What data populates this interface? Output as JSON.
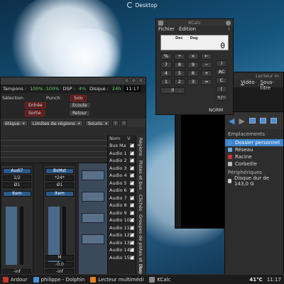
{
  "desktop": {
    "label": "Desktop"
  },
  "ardour": {
    "transport": {
      "tampons": "Tampons :",
      "tampons_val": "100% :100%",
      "dsp": "DSP :",
      "dsp_val": "4%",
      "disque": "Disque :",
      "disque_val": "24h",
      "time": "11:17"
    },
    "selection": "Sélection",
    "punch": "Punch",
    "entree": "Entrée",
    "sortie": "Sortie",
    "solo": "Solo",
    "ecoute": "Ecoute",
    "retour": "Retour",
    "row3": {
      "combo1": "étique",
      "combo2": "Limites de régions",
      "combo3": "Souris"
    },
    "list_headers": [
      "Nom",
      "V"
    ],
    "list_items": [
      "Bus Ma",
      "Audio 1",
      "Audio 2",
      "Audio 3",
      "Audio 4",
      "Audio 5",
      "Audio 6",
      "Audio 7",
      "Audio 8",
      "Audio 9",
      "Audio 10",
      "Audio 11",
      "Audio 12",
      "Audio 13",
      "Audio 14",
      "Audio 15"
    ],
    "vtabs": [
      "Régions",
      "Pistes et bus",
      "Clichés",
      "Groupes de pistes et bus",
      "Repè"
    ],
    "strip": {
      "name": "BsMst",
      "angle": "*24*",
      "in_label": "In",
      "out_label": "Ø1",
      "m": "M",
      "db": "-0.0",
      "inf": "-inf",
      "audi": "Audi7",
      "ratio": "1/2",
      "btn": "Ø1",
      "itemlabel": "Item",
      "l": "L"
    }
  },
  "media": {
    "title": "Lecteur m",
    "menu": [
      "Vidéo",
      "Sous-titre"
    ]
  },
  "dolphin": {
    "places_label": "Emplacements",
    "places": [
      {
        "label": "Dossier personnel",
        "color": "#4a90d9",
        "selected": true
      },
      {
        "label": "Réseau",
        "color": "#6aa8e6",
        "selected": false
      },
      {
        "label": "Racine",
        "color": "#cc3333",
        "selected": false
      },
      {
        "label": "Corbeille",
        "color": "#bbbbbb",
        "selected": false
      }
    ],
    "devices_label": "Périphériques",
    "devices": [
      {
        "label": "Disque dur de 143,0 G"
      }
    ]
  },
  "kcalc": {
    "title": "KCalc",
    "menu": [
      "Fichier",
      "Édition"
    ],
    "modes": [
      "Dec",
      "Deg"
    ],
    "display": "0",
    "buttons": [
      "%",
      "÷",
      "×",
      "←",
      "7",
      "8",
      "9",
      "−",
      "4",
      "5",
      "6",
      "+",
      "1",
      "2",
      "3",
      "=",
      "0",
      ".",
      "AC",
      "C",
      "(",
      ")",
      "+/−"
    ],
    "norm": "NORM"
  },
  "taskbar": {
    "items": [
      {
        "label": "Ardour",
        "color": "#c0392b"
      },
      {
        "label": "philippe - Dolphin",
        "color": "#4a90d9"
      },
      {
        "label": "Lecteur multimédi",
        "color": "#e67e22"
      },
      {
        "label": "KCalc",
        "color": "#888888"
      }
    ],
    "temp": "41°C",
    "clock": "11:17"
  }
}
